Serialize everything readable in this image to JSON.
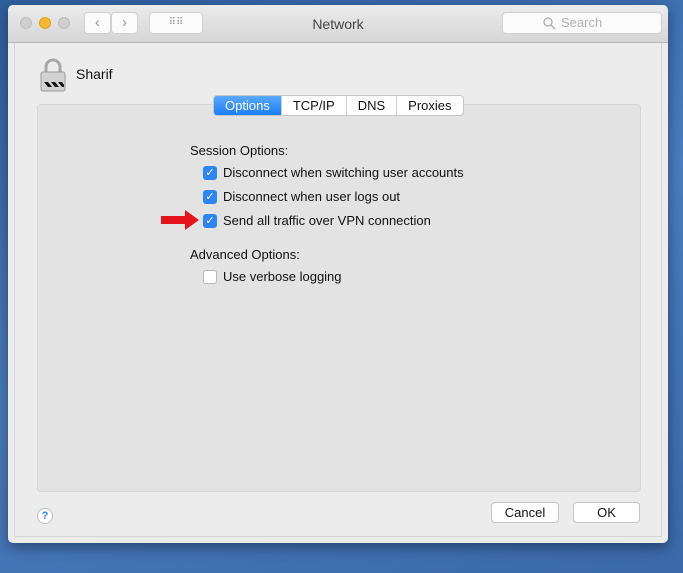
{
  "window": {
    "title": "Network",
    "search_placeholder": "Search"
  },
  "connection": {
    "name": "Sharif"
  },
  "tabs": [
    {
      "label": "Options",
      "active": true
    },
    {
      "label": "TCP/IP"
    },
    {
      "label": "DNS"
    },
    {
      "label": "Proxies"
    }
  ],
  "session": {
    "heading": "Session Options:",
    "options": [
      {
        "label": "Disconnect when switching user accounts",
        "checked": true
      },
      {
        "label": "Disconnect when user logs out",
        "checked": true
      },
      {
        "label": "Send all traffic over VPN connection",
        "checked": true
      }
    ]
  },
  "advanced": {
    "heading": "Advanced Options:",
    "options": [
      {
        "label": "Use verbose logging",
        "checked": false
      }
    ]
  },
  "buttons": {
    "cancel": "Cancel",
    "ok": "OK",
    "help": "?"
  },
  "colors": {
    "accent": "#2e86f6",
    "arrow": "#e5141b"
  }
}
